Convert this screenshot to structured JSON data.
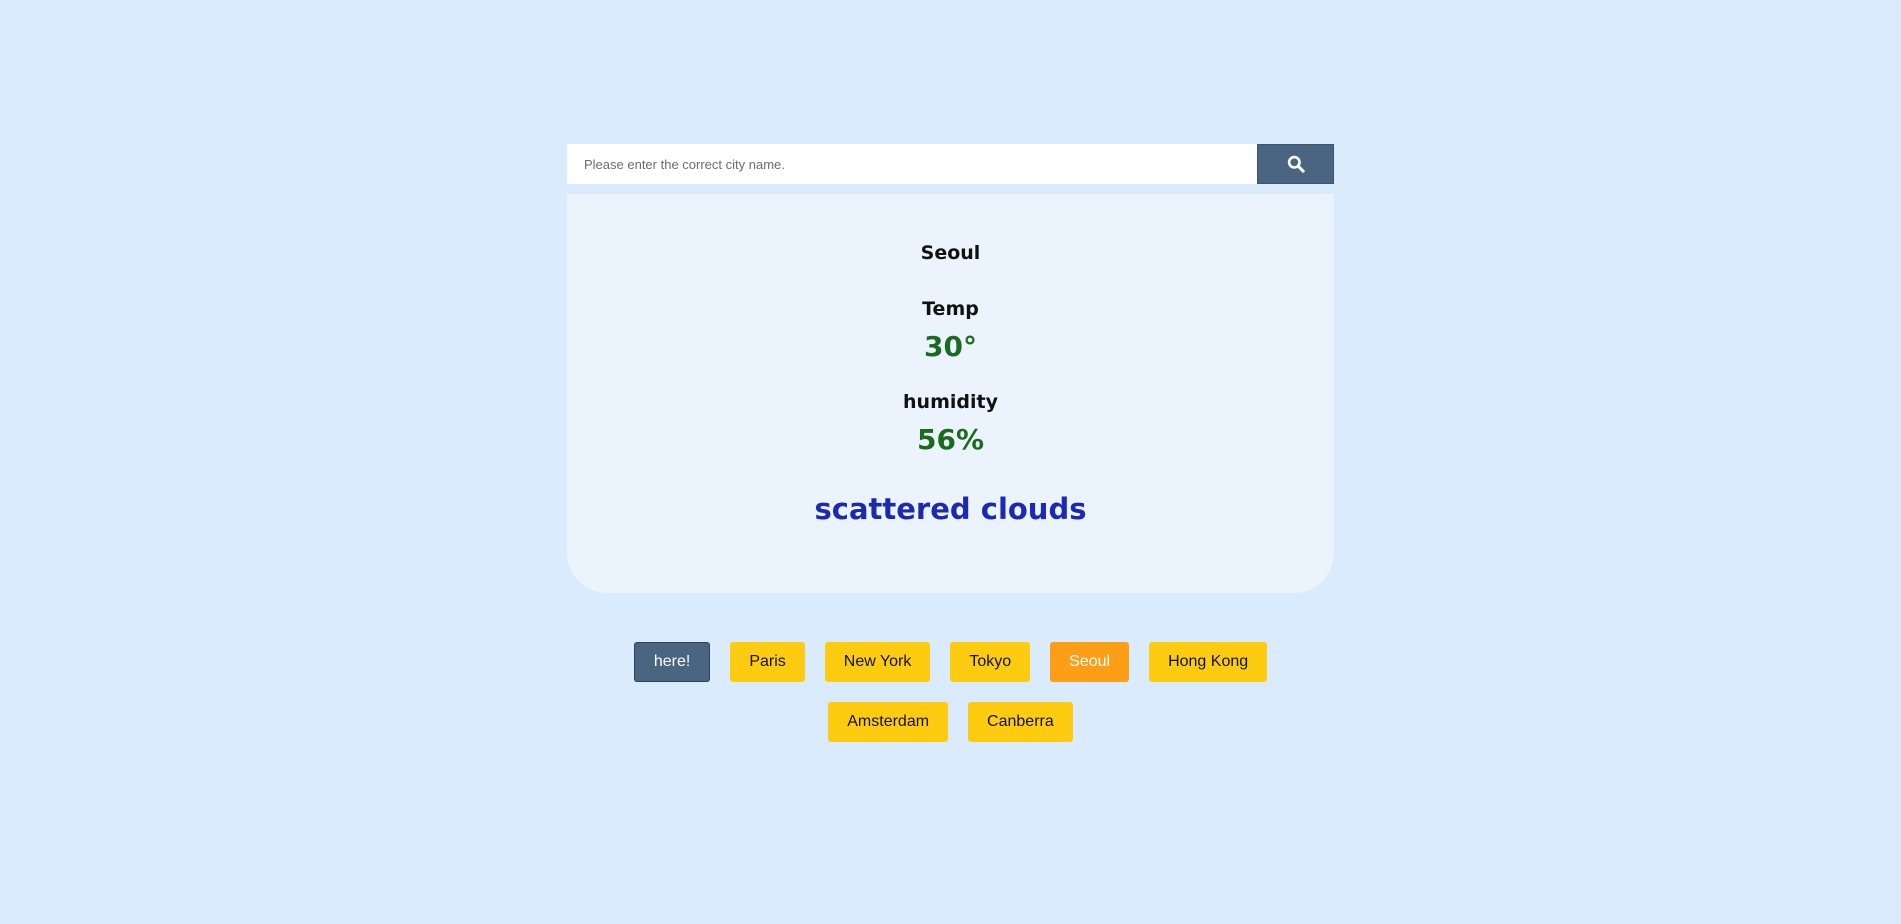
{
  "search": {
    "placeholder": "Please enter the correct city name.",
    "value": "",
    "button_icon": "search-icon"
  },
  "weather": {
    "city": "Seoul",
    "temp_label": "Temp",
    "temp_value": "30°",
    "humidity_label": "humidity",
    "humidity_value": "56%",
    "description": "scattered clouds"
  },
  "cities": [
    {
      "label": "here!"
    },
    {
      "label": "Paris"
    },
    {
      "label": "New York"
    },
    {
      "label": "Tokyo"
    },
    {
      "label": "Seoul"
    },
    {
      "label": "Hong Kong"
    },
    {
      "label": "Amsterdam"
    },
    {
      "label": "Canberra"
    }
  ],
  "colors": {
    "background": "#d9ebfc",
    "card": "#ebf4fd",
    "accent_button": "#4a6582",
    "city_button": "#fdcc10",
    "selected_city_button": "#fd9f16",
    "value_green": "#1b6b1e",
    "description_blue": "#1b2ab0"
  }
}
